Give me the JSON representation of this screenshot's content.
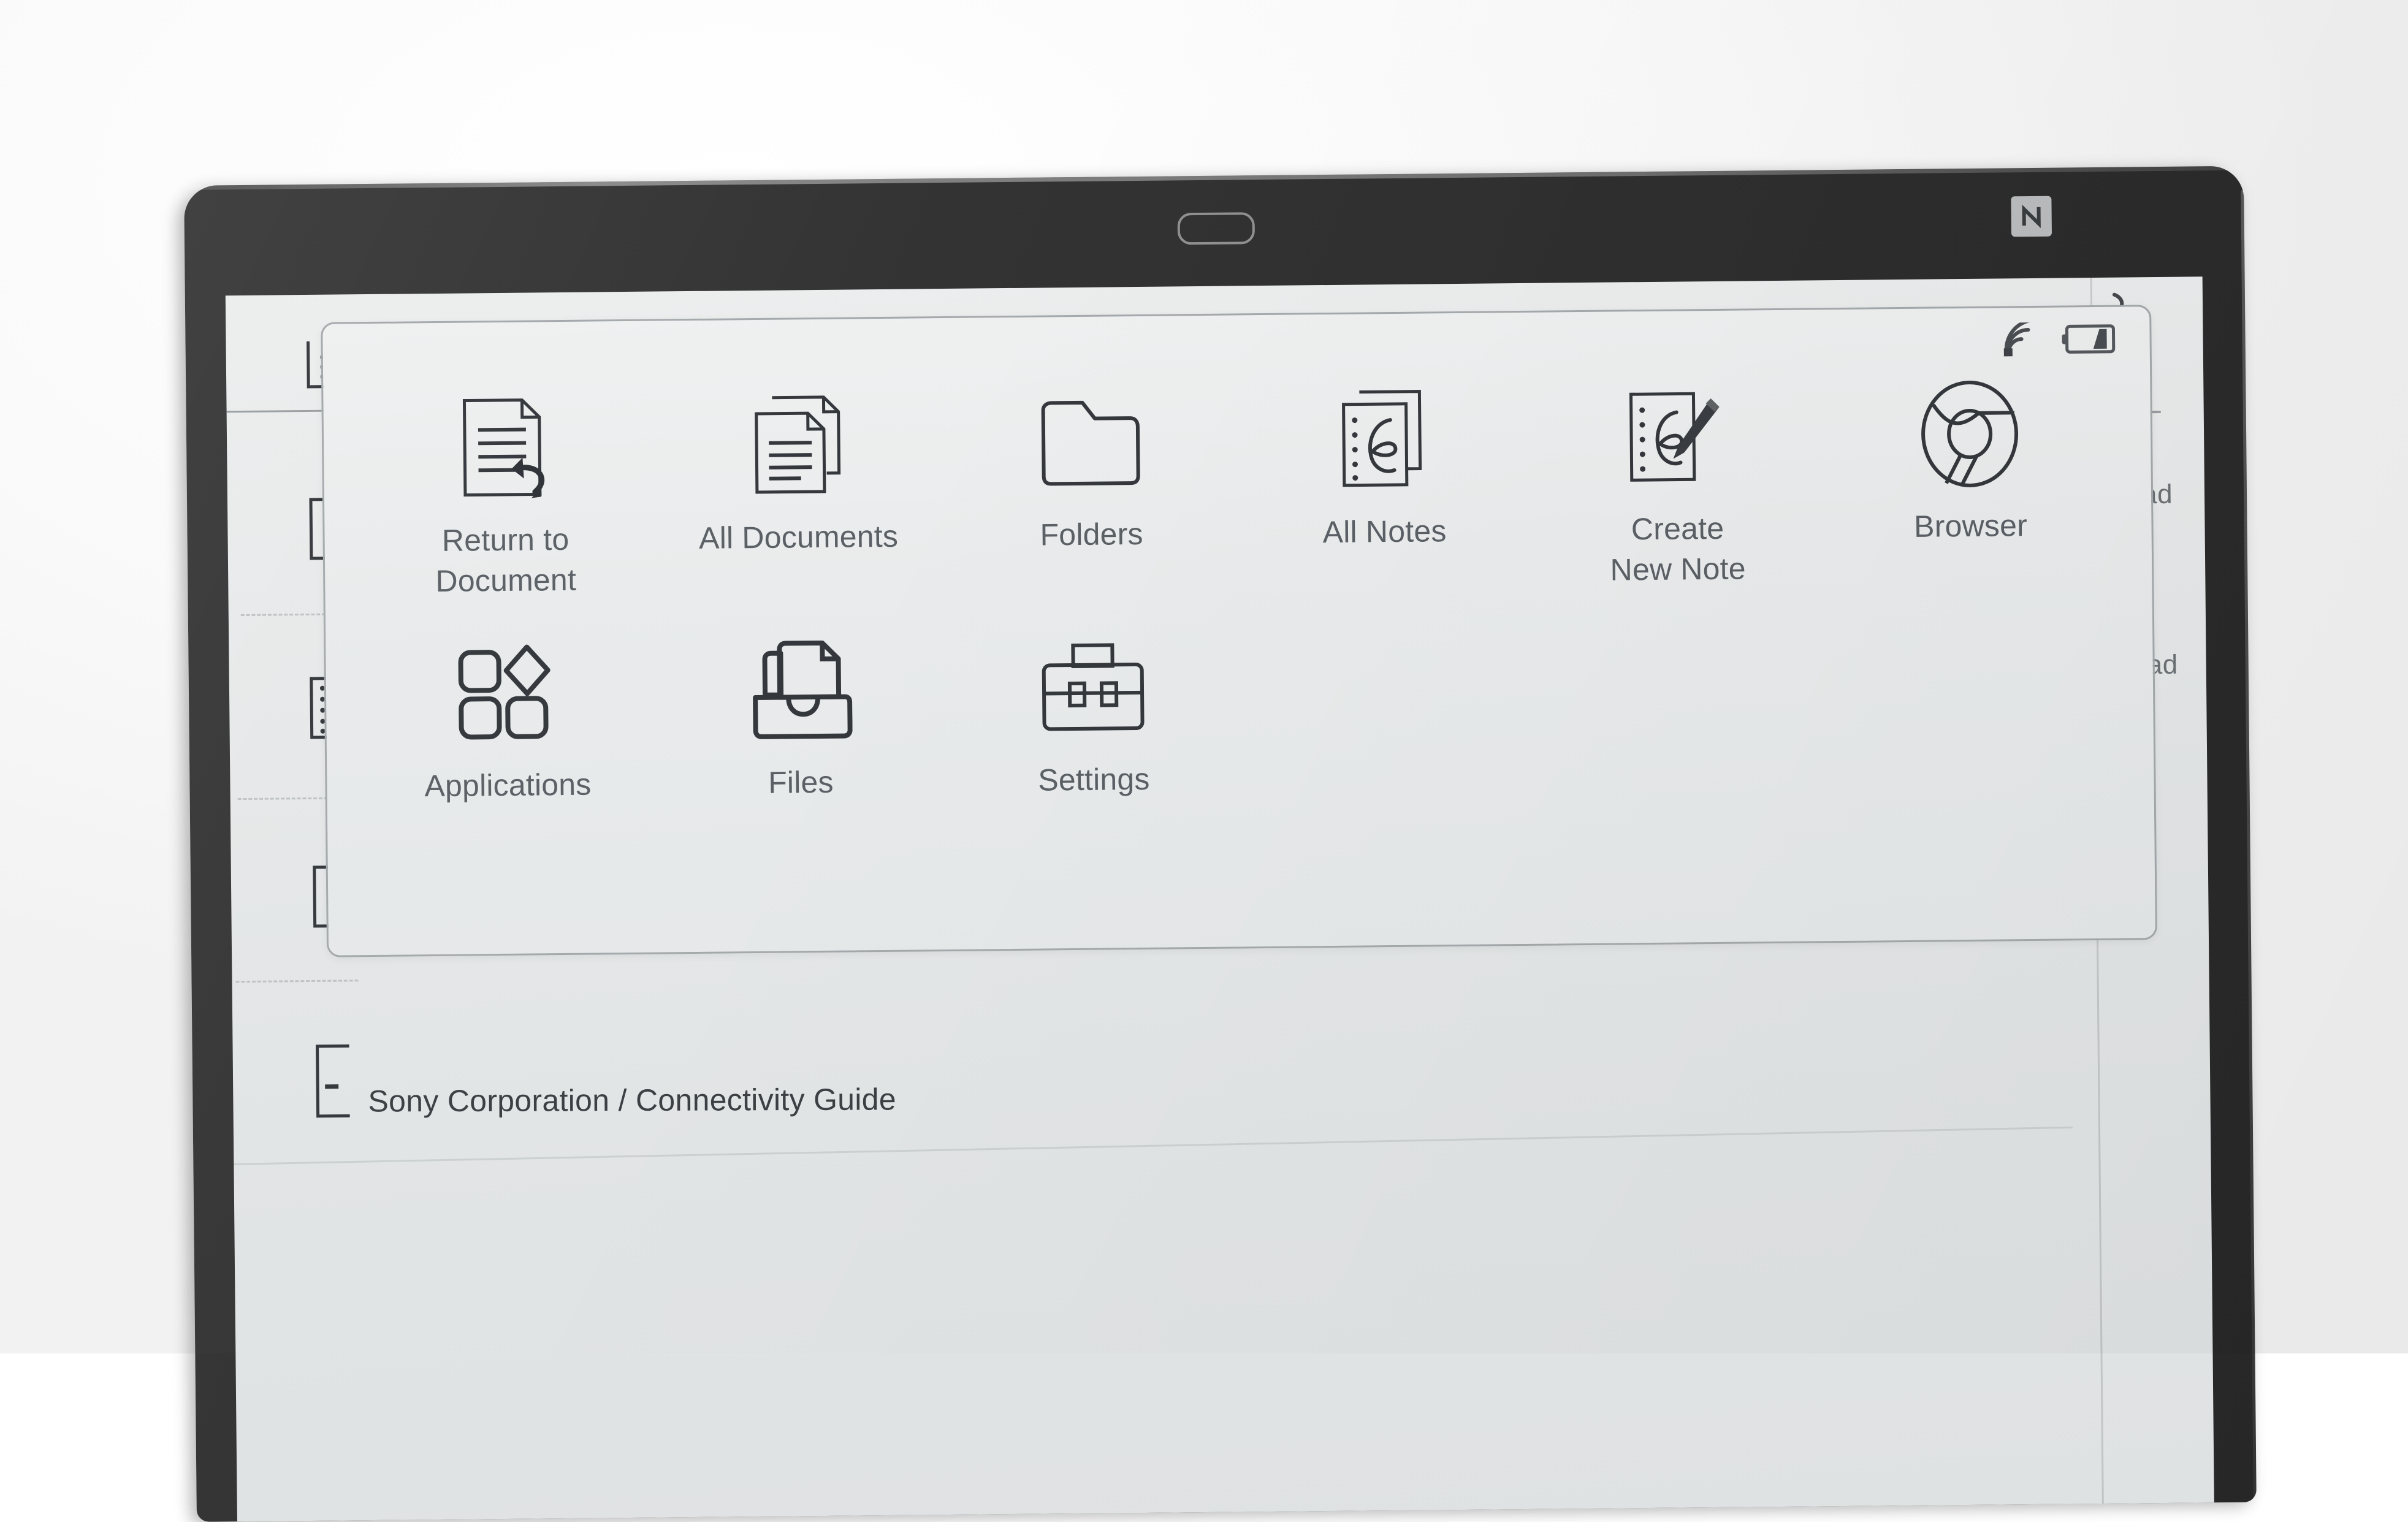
{
  "device": {
    "bezel_color": "#313131",
    "screen_bg_color": "#e7e9ea",
    "nfc_label": "N",
    "home_button_name": "home-button"
  },
  "launcher": {
    "status": {
      "wifi_icon": "wifi-icon",
      "battery_icon": "battery-icon"
    },
    "items": [
      {
        "icon": "document-return-icon",
        "label_line1": "Return to",
        "label_line2": "Document"
      },
      {
        "icon": "documents-stack-icon",
        "label_line1": "All Documents",
        "label_line2": ""
      },
      {
        "icon": "folder-icon",
        "label_line1": "Folders",
        "label_line2": ""
      },
      {
        "icon": "notes-stack-icon",
        "label_line1": "All Notes",
        "label_line2": ""
      },
      {
        "icon": "note-pencil-icon",
        "label_line1": "Create",
        "label_line2": "New Note"
      },
      {
        "icon": "chrome-browser-icon",
        "label_line1": "Browser",
        "label_line2": ""
      },
      {
        "icon": "applications-grid-icon",
        "label_line1": "Applications",
        "label_line2": ""
      },
      {
        "icon": "files-icon",
        "label_line1": "Files",
        "label_line2": ""
      },
      {
        "icon": "briefcase-settings-icon",
        "label_line1": "Settings",
        "label_line2": ""
      }
    ]
  },
  "document": {
    "footer_caption": "Sony Corporation / Connectivity Guide",
    "sidebar_icons": [
      "document-lines-icon",
      "bracket-icon",
      "notebook-dots-icon",
      "bracket-icon",
      "bracket-dash-icon"
    ],
    "right_fragments": [
      "ad",
      "ad"
    ]
  },
  "colors": {
    "ink": "#34383c",
    "label_text": "#5a6065",
    "panel_border": "#a4a9ac",
    "rule": "#c9cdcf"
  }
}
